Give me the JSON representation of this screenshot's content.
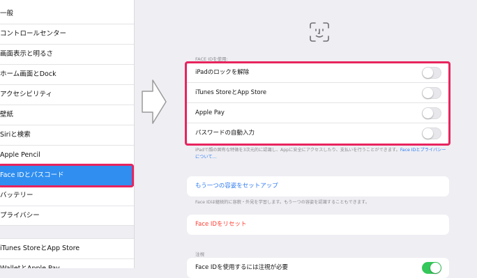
{
  "sidebar": {
    "items": [
      {
        "label": "一般"
      },
      {
        "label": "コントロールセンター"
      },
      {
        "label": "画面表示と明るさ"
      },
      {
        "label": "ホーム画面とDock"
      },
      {
        "label": "アクセシビリティ"
      },
      {
        "label": "壁紙"
      },
      {
        "label": "Siriと検索"
      },
      {
        "label": "Apple Pencil"
      },
      {
        "label": "Face IDとパスコード"
      },
      {
        "label": "バッテリー"
      },
      {
        "label": "プライバシー"
      },
      {
        "label": "iTunes StoreとApp Store"
      },
      {
        "label": "WalletとApple Pay"
      }
    ]
  },
  "face_id": {
    "section_header": "FACE IDを使用:",
    "rows": [
      {
        "label": "iPadのロックを解除",
        "on": false
      },
      {
        "label": "iTunes StoreとApp Store",
        "on": false
      },
      {
        "label": "Apple Pay",
        "on": false
      },
      {
        "label": "パスワードの自動入力",
        "on": false
      }
    ],
    "footer_text": "iPadで顔の固有な特徴を3次元的に認識し、Appに安全にアクセスしたり、支払いを行うことができます。",
    "footer_link": "Face IDとプライバシーについて…"
  },
  "alternate": {
    "label": "もう一つの容姿をセットアップ",
    "note": "Face IDは継続的に容貌・外見を学習します。もう一つの容姿を認識することもできます。"
  },
  "reset": {
    "label": "Face IDをリセット"
  },
  "attention": {
    "section_header": "注視",
    "row_label": "Face IDを使用するには注視が必要",
    "on": true
  },
  "colors": {
    "accent": "#2f7bf0",
    "highlight": "#e8245e",
    "destructive": "#ff3b30",
    "toggle_on": "#34c759"
  },
  "icons": {
    "face_id": "face-id-icon",
    "arrow": "right-arrow-icon"
  }
}
